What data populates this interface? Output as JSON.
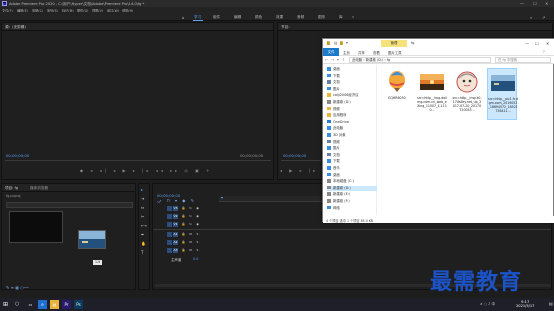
{
  "titlebar": {
    "title": "Adobe Premiere Pro 2020 - C:\\用户\\Hyper\\文档\\Adobe\\Premiere Pro\\14.0\\fg *",
    "logo": "Pr",
    "window_controls": [
      "—",
      "☐",
      "✕"
    ]
  },
  "menubar": {
    "items": [
      "文件(F)",
      "编辑(E)",
      "剪辑(C)",
      "序列(S)",
      "标记(M)",
      "图形(G)",
      "视图(V)",
      "窗口(W)",
      "帮助(H)"
    ]
  },
  "workspaces": {
    "tabs": [
      "学习",
      "组件",
      "编辑",
      "颜色",
      "效果",
      "音频",
      "图形",
      "库"
    ],
    "active_index": 0,
    "more": "»"
  },
  "source_panel": {
    "title": "源：(无剪辑)",
    "timecode": "00;00;00;00",
    "duration": "00;00;00;00",
    "controls": "◆ ◂ ◂| ◂ ▶ ▸ |▸ ◂◂ ▸▸ ◎ ▣ +"
  },
  "program_panel": {
    "title": "节目：",
    "timecode": "00;00;00;00",
    "duration": "00;00;00;00",
    "controls": "◂ ▶ ▸ |▸ ◂◂ ▸▸ ◎ ▣ +"
  },
  "project_panel": {
    "title": "项目: fg",
    "tab2": "媒体浏览器",
    "bin_label": "fg.prproj",
    "item_label": "序列",
    "tooltip": "1-9"
  },
  "timeline_panel": {
    "timecode": "00;00;00;00",
    "tracks_v": [
      "V3",
      "V2",
      "V1"
    ],
    "tracks_a": [
      "A1",
      "A2",
      "A3"
    ],
    "master": "主声道",
    "master_value": "0.0"
  },
  "explorer": {
    "manage_tab": "管理",
    "folder_name": "fg",
    "ribbon": [
      "文件",
      "主页",
      "共享",
      "查看",
      "图片工具"
    ],
    "address": "此电脑 › 新建卷 (D:) › fg",
    "search_placeholder": "在 fg 中搜索",
    "nav_items": [
      {
        "label": "桌面",
        "icon": "desktop-icon",
        "color": "#3b8de0"
      },
      {
        "label": "下载",
        "icon": "download-icon",
        "color": "#3b8de0"
      },
      {
        "label": "文档",
        "icon": "document-icon",
        "color": "#6b7fa6"
      },
      {
        "label": "图片",
        "icon": "picture-icon",
        "color": "#3b8de0"
      },
      {
        "label": "caiji2006经济议",
        "icon": "folder-icon",
        "color": "#e8b43d"
      },
      {
        "label": "新建卷 (D:)",
        "icon": "drive-icon",
        "color": "#8a8a8a"
      },
      {
        "label": "视频",
        "icon": "folder-icon",
        "color": "#e8b43d"
      },
      {
        "label": "应用程序",
        "icon": "folder-icon",
        "color": "#e8b43d"
      },
      {
        "label": "OneDrive",
        "icon": "cloud-icon",
        "color": "#2b7cd3"
      },
      {
        "label": "此电脑",
        "icon": "pc-icon",
        "color": "#3b8de0"
      },
      {
        "label": "3D 对象",
        "icon": "cube-icon",
        "color": "#3b8de0"
      },
      {
        "label": "视频",
        "icon": "video-icon",
        "color": "#6b7fa6"
      },
      {
        "label": "图片",
        "icon": "picture-icon",
        "color": "#3b8de0"
      },
      {
        "label": "文档",
        "icon": "document-icon",
        "color": "#6b7fa6"
      },
      {
        "label": "下载",
        "icon": "download-icon",
        "color": "#3b8de0"
      },
      {
        "label": "音乐",
        "icon": "music-icon",
        "color": "#3b8de0"
      },
      {
        "label": "桌面",
        "icon": "desktop-icon",
        "color": "#3b8de0"
      },
      {
        "label": "本地磁盘 (C:)",
        "icon": "drive-icon",
        "color": "#8a8a8a"
      },
      {
        "label": "新建卷 (D:)",
        "icon": "drive-icon",
        "color": "#8a8a8a"
      },
      {
        "label": "新建卷 (E:)",
        "icon": "drive-icon",
        "color": "#8a8a8a"
      },
      {
        "label": "新建卷 (F:)",
        "icon": "drive-icon",
        "color": "#8a8a8a"
      },
      {
        "label": "网络",
        "icon": "network-icon",
        "color": "#3b8de0"
      }
    ],
    "nav_selected_index": 18,
    "files": [
      {
        "name": "EQHR6050",
        "thumb": "balloon-thumb"
      },
      {
        "name": "src=http__img.dailmg.com.cn_web_eXing_11007_1-1110...",
        "thumb": "sunset-thumb"
      },
      {
        "name": "src=http__img.k0.17Valley.net_up_2017-07-20_20170720053...",
        "thumb": "cartoon-thumb"
      },
      {
        "name": "src=http__pic1.fr.dgm.com_2019052_18694572_18521738411...",
        "thumb": "ocean-thumb"
      }
    ],
    "selected_file_index": 3,
    "status": "4 个项目    选中 1 个项目  85.0 KB"
  },
  "taskbar": {
    "start_icon": "⊞",
    "apps": [
      {
        "label": "e",
        "color": "#1f6fd0"
      },
      {
        "label": "▤",
        "color": "#e8b43d"
      },
      {
        "label": "Pr",
        "color": "#2a1a6e"
      },
      {
        "label": "Ps",
        "color": "#0a3b5c"
      }
    ],
    "tray": "∧ ◌ ♪ 中",
    "time": "9:17",
    "date": "2021/5/17"
  },
  "watermark": {
    "text": "最需教育"
  }
}
